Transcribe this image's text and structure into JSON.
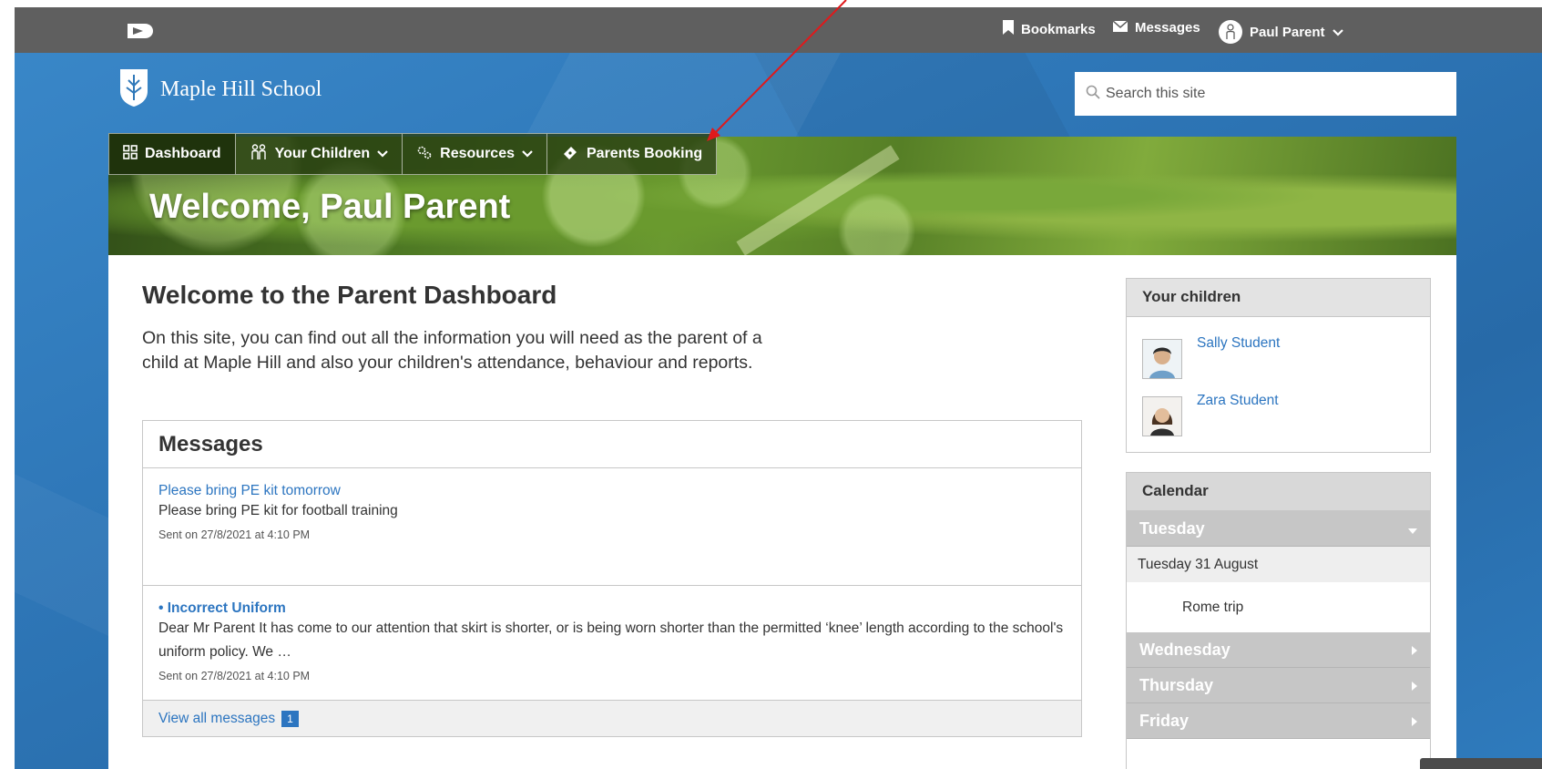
{
  "topbar": {
    "bookmarks_label": "Bookmarks",
    "messages_label": "Messages",
    "user_name": "Paul Parent"
  },
  "school": {
    "name": "Maple Hill School"
  },
  "search": {
    "placeholder": "Search this site"
  },
  "nav": {
    "dashboard": "Dashboard",
    "your_children": "Your Children",
    "resources": "Resources",
    "parents_booking": "Parents Booking"
  },
  "banner": {
    "welcome": "Welcome, Paul Parent"
  },
  "main": {
    "title": "Welcome to the Parent Dashboard",
    "intro": "On this site, you can find out all the information you will need as the parent of a child at Maple Hill and also your children's attendance, behaviour and reports."
  },
  "messages": {
    "heading": "Messages",
    "items": [
      {
        "title": "Please bring PE kit tomorrow",
        "body": "Please bring PE kit for football training",
        "date": "Sent on 27/8/2021 at 4:10 PM"
      },
      {
        "title": "Incorrect Uniform",
        "body": "Dear Mr Parent It has come to our attention that skirt is shorter, or is being worn shorter than the permitted ‘knee’ length according to the school's uniform policy. We …",
        "date": "Sent on 27/8/2021 at 4:10 PM"
      }
    ],
    "view_all": "View all messages",
    "unread_count": "1"
  },
  "children_panel": {
    "heading": "Your children",
    "children": [
      "Sally Student",
      "Zara Student"
    ]
  },
  "calendar": {
    "heading": "Calendar",
    "days": [
      "Tuesday",
      "Wednesday",
      "Thursday",
      "Friday"
    ],
    "tuesday_date": "Tuesday 31 August",
    "tuesday_event": "Rome trip"
  },
  "colors": {
    "topbar": "#5f5f5f",
    "link": "#2c75c0",
    "annotation_arrow": "#e0191b"
  }
}
